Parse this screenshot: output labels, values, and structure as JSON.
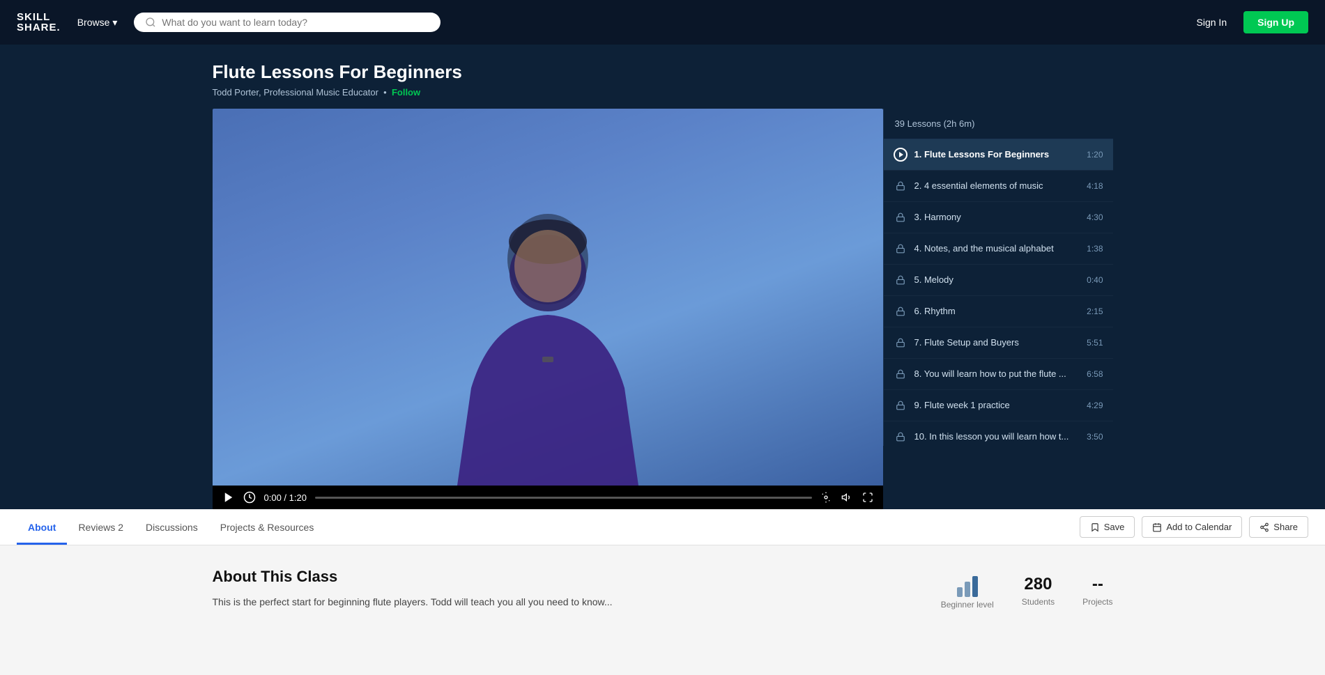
{
  "nav": {
    "logo_line1": "SKILL",
    "logo_line2": "SHARE.",
    "browse_label": "Browse",
    "search_placeholder": "What do you want to learn today?",
    "signin_label": "Sign In",
    "signup_label": "Sign Up"
  },
  "course": {
    "title": "Flute Lessons For Beginners",
    "author": "Todd Porter, Professional Music Educator",
    "follow_label": "Follow"
  },
  "video": {
    "current_time": "0:00",
    "duration": "1:20",
    "time_display": "0:00 / 1:20"
  },
  "playlist": {
    "header": "39 Lessons (2h 6m)",
    "items": [
      {
        "number": "1",
        "label": "1. Flute Lessons For Beginners",
        "duration": "1:20",
        "active": true,
        "locked": false
      },
      {
        "number": "2",
        "label": "2. 4 essential elements of music",
        "duration": "4:18",
        "active": false,
        "locked": true
      },
      {
        "number": "3",
        "label": "3. Harmony",
        "duration": "4:30",
        "active": false,
        "locked": true
      },
      {
        "number": "4",
        "label": "4. Notes, and the musical alphabet",
        "duration": "1:38",
        "active": false,
        "locked": true
      },
      {
        "number": "5",
        "label": "5. Melody",
        "duration": "0:40",
        "active": false,
        "locked": true
      },
      {
        "number": "6",
        "label": "6. Rhythm",
        "duration": "2:15",
        "active": false,
        "locked": true
      },
      {
        "number": "7",
        "label": "7. Flute Setup and Buyers",
        "duration": "5:51",
        "active": false,
        "locked": true
      },
      {
        "number": "8",
        "label": "8. You will learn how to put the flute ...",
        "duration": "6:58",
        "active": false,
        "locked": true
      },
      {
        "number": "9",
        "label": "9. Flute week 1 practice",
        "duration": "4:29",
        "active": false,
        "locked": true
      },
      {
        "number": "10",
        "label": "10. In this lesson you will learn how t...",
        "duration": "3:50",
        "active": false,
        "locked": true
      }
    ]
  },
  "tabs": {
    "items": [
      {
        "id": "about",
        "label": "About",
        "active": true
      },
      {
        "id": "reviews",
        "label": "Reviews  2",
        "active": false
      },
      {
        "id": "discussions",
        "label": "Discussions",
        "active": false
      },
      {
        "id": "projects",
        "label": "Projects & Resources",
        "active": false
      }
    ],
    "actions": [
      {
        "id": "save",
        "label": "Save",
        "icon": "bookmark"
      },
      {
        "id": "calendar",
        "label": "Add to Calendar",
        "icon": "calendar"
      },
      {
        "id": "share",
        "label": "Share",
        "icon": "share"
      }
    ]
  },
  "about": {
    "title": "About This Class",
    "description": "This is the perfect start for beginning flute players. Todd will teach you all you need to know...",
    "level_label": "Beginner level",
    "students_count": "280",
    "students_label": "Students",
    "projects_label": "--",
    "projects_sublabel": "Projects"
  }
}
